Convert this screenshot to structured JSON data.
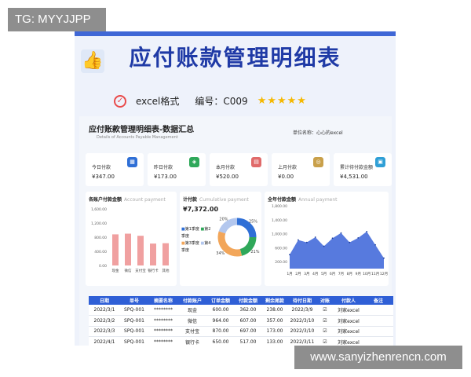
{
  "watermark_top": "TG: MYYJJPP",
  "watermark_bottom": "www.sanyizhenrencn.com",
  "banner": {
    "title": "应付账款管理明细表",
    "format_label": "excel格式",
    "code_label": "编号：C009",
    "stars": "★★★★★",
    "thumb_icon": "thumbs-up-icon",
    "check_icon": "check-circle-icon"
  },
  "sheet": {
    "title": "应付账款管理明细表-数据汇总",
    "subtitle": "Details of Accounts Payable Management",
    "unit_label": "单位名称：心心的excel"
  },
  "kpis": [
    {
      "label": "今日付款",
      "value": "¥347.00",
      "icon_color": "#2f6fd6"
    },
    {
      "label": "昨日付款",
      "value": "¥173.00",
      "icon_color": "#2fa85a"
    },
    {
      "label": "本月付款",
      "value": "¥520.00",
      "icon_color": "#e06a6a"
    },
    {
      "label": "上月付款",
      "value": "¥0.00",
      "icon_color": "#c9a04a"
    },
    {
      "label": "累计待付款金额",
      "value": "¥4,531.00",
      "icon_color": "#2f9fd6"
    }
  ],
  "bar_card": {
    "title": "各账户付款金额",
    "title_en": "Account payment"
  },
  "donut_card": {
    "title": "计付款",
    "title_en": "Cumulative payment",
    "total": "¥7,372.00",
    "legend": [
      "第1季度",
      "第2季度",
      "第3季度",
      "第4季度"
    ]
  },
  "area_card": {
    "title": "全年付款金额",
    "title_en": "Annual payment"
  },
  "chart_data": [
    {
      "type": "bar",
      "title": "各账户付款金额",
      "categories": [
        "现金",
        "微信",
        "支付宝",
        "银行卡",
        "其他"
      ],
      "values": [
        880,
        900,
        840,
        620,
        630
      ],
      "ylim": [
        0,
        1600
      ],
      "yticks": [
        "1,600.00",
        "1,400.00",
        "1,200.00",
        "1,000.00",
        "800.00",
        "600.00",
        "400.00",
        "200.00",
        "0.00"
      ],
      "color": "#f0a0a0"
    },
    {
      "type": "pie",
      "title": "累计付款",
      "categories": [
        "第1季度",
        "第2季度",
        "第3季度",
        "第4季度"
      ],
      "values": [
        25,
        21,
        34,
        20
      ],
      "labels": [
        "25%",
        "21%",
        "34%",
        "20%"
      ],
      "colors": [
        "#2f6fd6",
        "#2fa85a",
        "#f2a65a",
        "#b3c7ee"
      ]
    },
    {
      "type": "area",
      "title": "全年付款金额",
      "categories": [
        "1月",
        "2月",
        "3月",
        "4月",
        "5月",
        "6月",
        "7月",
        "8月",
        "9月",
        "10月",
        "11月",
        "12月"
      ],
      "values": [
        400,
        820,
        750,
        900,
        640,
        870,
        1020,
        750,
        880,
        1060,
        680,
        300
      ],
      "ylim": [
        0,
        1800
      ],
      "yticks": [
        "1,800.00",
        "1,600.00",
        "1,400.00",
        "1,200.00",
        "1,000.00",
        "800.00",
        "600.00",
        "400.00",
        "200.00",
        "0.00"
      ],
      "color": "#3a63d8"
    }
  ],
  "table": {
    "headers": [
      "日期",
      "单号",
      "摘要名称",
      "付款账户",
      "订单金额",
      "付款金额",
      "剩余尾款",
      "待付日期",
      "对账",
      "付款人",
      "备注"
    ],
    "rows": [
      [
        "2022/3/1",
        "SPQ-001",
        "********",
        "现金",
        "600.00",
        "362.00",
        "238.00",
        "2022/3/9",
        "☑",
        "刘家excel",
        ""
      ],
      [
        "2022/3/2",
        "SPQ-001",
        "********",
        "微信",
        "964.00",
        "607.00",
        "357.00",
        "2022/3/10",
        "☑",
        "刘家excel",
        ""
      ],
      [
        "2022/3/3",
        "SPQ-001",
        "********",
        "支付宝",
        "870.00",
        "697.00",
        "173.00",
        "2022/3/10",
        "☑",
        "刘家excel",
        ""
      ],
      [
        "2022/4/1",
        "SPQ-001",
        "********",
        "银行卡",
        "650.00",
        "517.00",
        "133.00",
        "2022/3/11",
        "☑",
        "刘家excel",
        ""
      ],
      [
        "2022/5/1",
        "SPQ-001",
        "********",
        "其他",
        "890.00",
        "611.00",
        "279.00",
        "2022/3/12",
        "☑",
        "刘家excel",
        ""
      ],
      [
        "2022/6/1",
        "SPQ-001",
        "********",
        "现金",
        "750.00",
        "317.00",
        "433.00",
        "2022/3/13",
        "☑",
        "刘家excel",
        ""
      ],
      [
        "2022/7/1",
        "SPQ-001",
        "********",
        "现金",
        "895.00",
        "620.00",
        "275.00",
        "2022/3/14",
        "☑",
        "刘家excel",
        ""
      ]
    ]
  }
}
